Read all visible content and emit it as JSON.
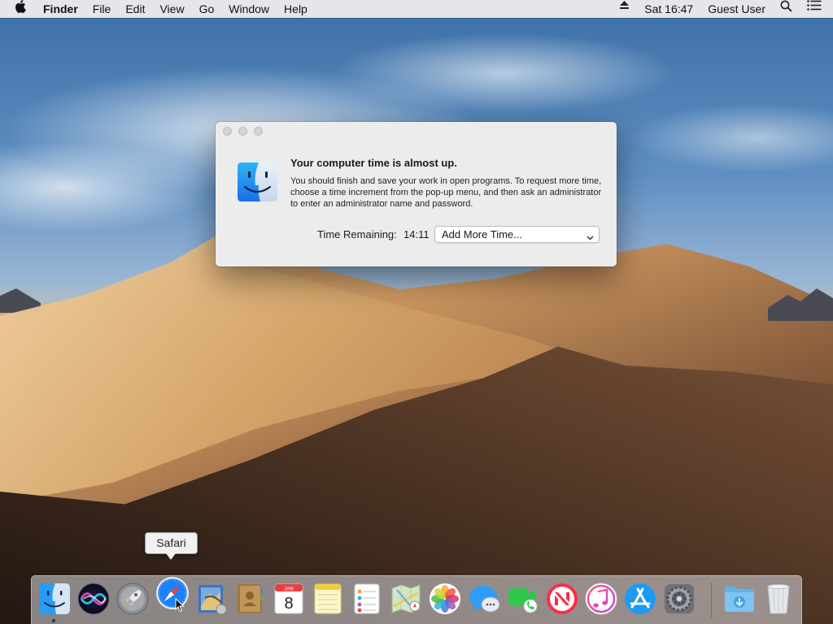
{
  "menubar": {
    "app_name": "Finder",
    "menus": [
      "File",
      "Edit",
      "View",
      "Go",
      "Window",
      "Help"
    ],
    "clock": "Sat 16:47",
    "user": "Guest User",
    "icons": [
      "apple-icon",
      "eject-icon",
      "spotlight-search-icon",
      "notification-center-icon"
    ]
  },
  "dialog": {
    "title": "Your computer time is almost up.",
    "body": "You should finish and save your work in open programs. To request more time, choose a time increment from the pop-up menu, and then ask an administrator to enter an administrator name and password.",
    "time_label": "Time Remaining:",
    "time_value": "14:11",
    "select_value": "Add More Time...",
    "icon": "finder-icon"
  },
  "tooltip": {
    "text": "Safari"
  },
  "dock": {
    "items": [
      {
        "name": "Finder",
        "icon": "finder-icon",
        "running": true
      },
      {
        "name": "Siri",
        "icon": "siri-icon"
      },
      {
        "name": "Launchpad",
        "icon": "launchpad-icon"
      },
      {
        "name": "Safari",
        "icon": "safari-icon",
        "hovered": true
      },
      {
        "name": "Mail",
        "icon": "mail-icon"
      },
      {
        "name": "Contacts",
        "icon": "contacts-icon"
      },
      {
        "name": "Calendar",
        "icon": "calendar-icon",
        "month": "JAN",
        "day": "8"
      },
      {
        "name": "Notes",
        "icon": "notes-icon"
      },
      {
        "name": "Reminders",
        "icon": "reminders-icon"
      },
      {
        "name": "Maps",
        "icon": "maps-icon"
      },
      {
        "name": "Photos",
        "icon": "photos-icon"
      },
      {
        "name": "Messages",
        "icon": "messages-icon"
      },
      {
        "name": "FaceTime",
        "icon": "facetime-icon"
      },
      {
        "name": "News",
        "icon": "news-icon"
      },
      {
        "name": "iTunes",
        "icon": "itunes-icon"
      },
      {
        "name": "App Store",
        "icon": "app-store-icon"
      },
      {
        "name": "System Preferences",
        "icon": "system-preferences-icon"
      },
      {
        "name": "Downloads",
        "icon": "downloads-folder-icon"
      },
      {
        "name": "Trash",
        "icon": "trash-icon"
      }
    ]
  },
  "colors": {
    "accent": "#1a82fb",
    "dialog_bg": "#ececec",
    "menubar_bg": "#ebebeb"
  }
}
